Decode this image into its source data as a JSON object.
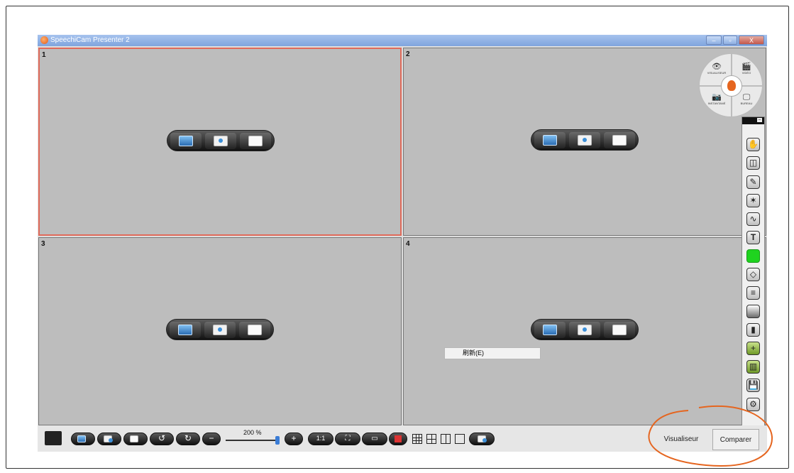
{
  "window": {
    "title": "SpeechiCam Presenter 2",
    "buttons": {
      "minimize": "–",
      "restore": "▫",
      "close": "X"
    }
  },
  "panes": [
    {
      "number": "1",
      "active": true
    },
    {
      "number": "2",
      "active": false
    },
    {
      "number": "3",
      "active": false
    },
    {
      "number": "4",
      "active": false
    }
  ],
  "mode_wheel": {
    "visualiseur": "VISUALISEUR",
    "video": "VIDÉO",
    "instantane": "INSTANTANÉ",
    "bureau": "BUREAU"
  },
  "toolbar": {
    "zoom_label": "200 %"
  },
  "context_menu": {
    "refresh": "刷新(E)"
  },
  "tabs": {
    "visualiseur": "Visualiseur",
    "comparer": "Comparer"
  },
  "colors": {
    "accent_orange": "#e5651f",
    "active_pane_border": "#e06a5a",
    "pen_color": "#1fd31f"
  }
}
